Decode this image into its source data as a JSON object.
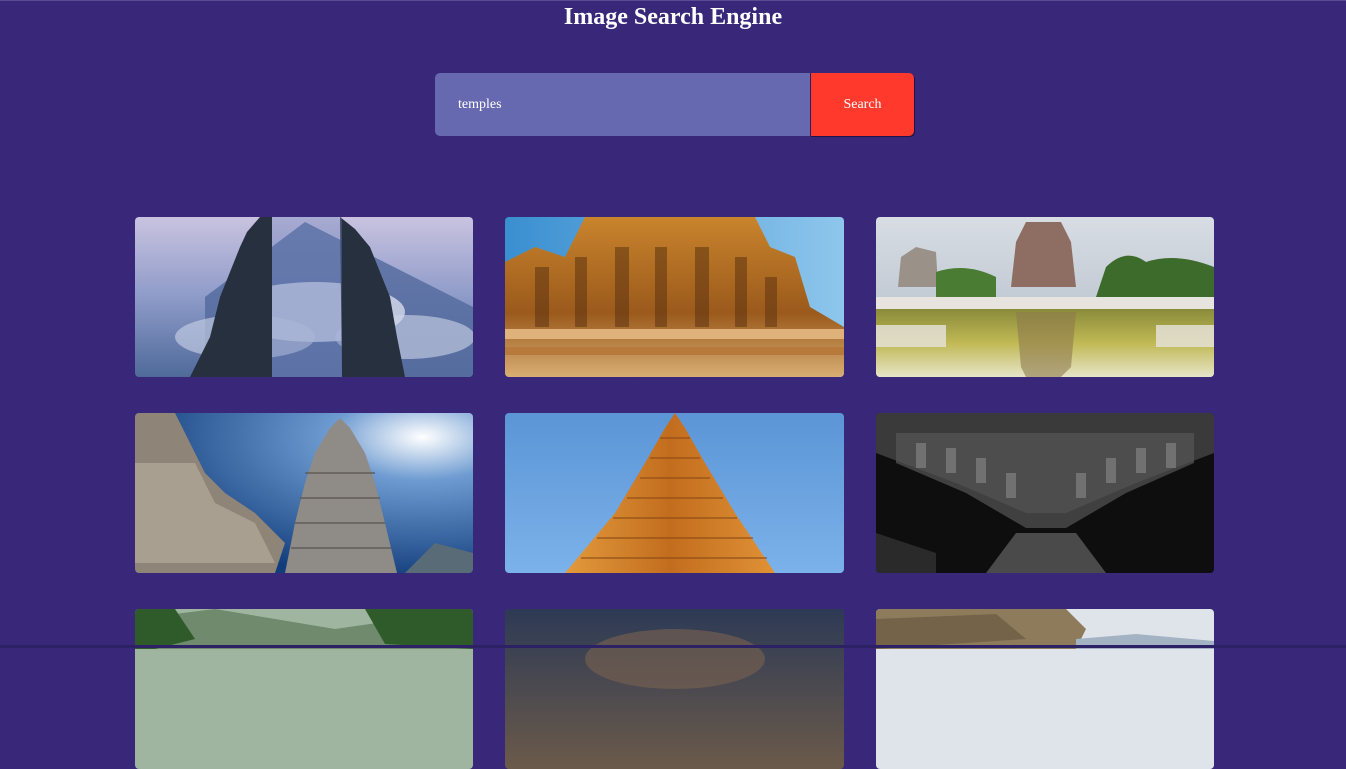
{
  "header": {
    "title": "Image Search Engine"
  },
  "search": {
    "value": "temples",
    "button_label": "Search"
  },
  "results": [
    {
      "name": "bali-gate-temple-image"
    },
    {
      "name": "carved-gopuram-temple-image"
    },
    {
      "name": "temple-pond-reflection-image"
    },
    {
      "name": "hampi-temple-tower-image"
    },
    {
      "name": "brihadeeswarar-tower-image"
    },
    {
      "name": "black-white-carvings-image"
    },
    {
      "name": "palm-valley-image"
    },
    {
      "name": "dusk-sky-image"
    },
    {
      "name": "cliff-landscape-image"
    }
  ],
  "colors": {
    "background": "#39287a",
    "input_bg": "#6769b0",
    "button_bg": "#ff3a2d",
    "text": "#ffffff"
  }
}
